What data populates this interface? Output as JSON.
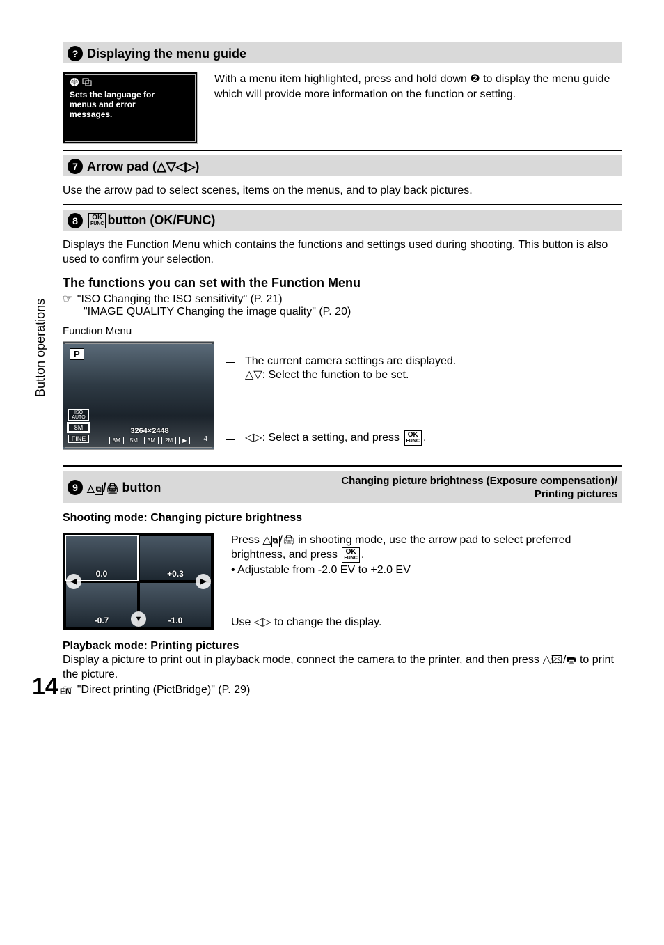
{
  "sections": {
    "menuGuide": {
      "title": "Displaying the menu guide",
      "langBoxLine1": "Sets the language for",
      "langBoxLine2": "menus and error",
      "langBoxLine3": "messages.",
      "para": "With a menu item highlighted, press and hold down ❷ to display the menu guide which will provide more information on the function or setting."
    },
    "arrowPad": {
      "num": "7",
      "title": "Arrow pad (△▽◁▷)",
      "para": "Use the arrow pad to select scenes, items on the menus, and to play back pictures."
    },
    "okFunc": {
      "num": "8",
      "okTop": "OK",
      "okBot": "FUNC",
      "title": " button (OK/FUNC)",
      "para": "Displays the Function Menu which contains the functions and settings used during shooting. This button is also used to confirm your selection.",
      "subhead": "The functions you can set with the Function Menu",
      "ref1": "\"ISO Changing the ISO sensitivity\" (P. 21)",
      "ref2": "\"IMAGE QUALITY Changing the image quality\" (P. 20)",
      "funcMenuLabel": "Function Menu",
      "lcd": {
        "p": "P",
        "iso": "ISO AUTO",
        "eight": "8M",
        "fine": "FINE",
        "res": "3264×2448",
        "t1": "8M",
        "t2": "5M",
        "t3": "3M",
        "t4": "2M",
        "frac": "4"
      },
      "expTop1": "The current camera settings are displayed.",
      "expTop2": "△▽: Select the function to be set.",
      "expBot": "◁▷: Select a setting, and press "
    },
    "evBtn": {
      "num": "9",
      "titleLeft": " button",
      "titleRight1": "Changing picture brightness (Exposure compensation)/",
      "titleRight2": "Printing pictures",
      "shootHead": "Shooting mode: Changing picture brightness",
      "ev": {
        "tl": "0.0",
        "tr": "+0.3",
        "bl": "-0.7",
        "br": "-1.0"
      },
      "shootParaPre": "Press △",
      "shootParaMid": " in shooting mode, use the arrow pad to select preferred brightness, and press ",
      "shootBullet": "Adjustable from -2.0 EV to +2.0 EV",
      "displayLine": "Use ◁▷ to change the display.",
      "pbHead": "Playback mode: Printing pictures",
      "pbPara": "Display a picture to print out in playback mode, connect the camera to the printer, and then press △🖾/🖶 to print the picture.",
      "pbRef": "\"Direct printing (PictBridge)\" (P. 29)"
    }
  },
  "sideTab": "Button operations",
  "pageNumber": "14",
  "pageLang": "EN",
  "glyphs": {
    "hand": "☞",
    "qmark": "?",
    "evSlash": "/",
    "ok": "OK",
    "func": "FUNC",
    "dot": "."
  }
}
